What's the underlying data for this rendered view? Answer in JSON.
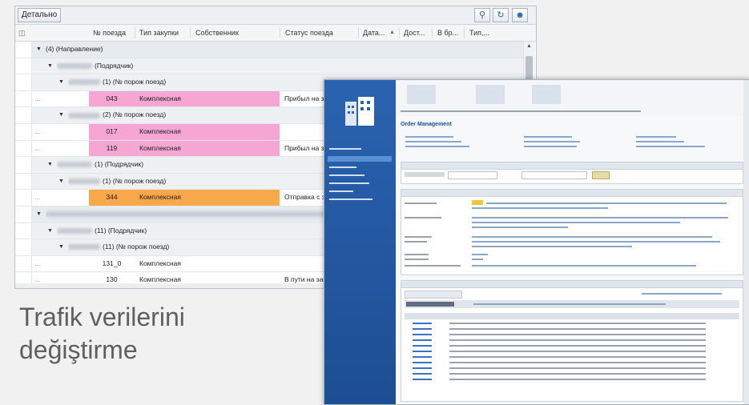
{
  "toolbar": {
    "details_label": "Детально"
  },
  "columns": [
    "№ поезда",
    "Тип закупки",
    "Собственник",
    "Статус поезда",
    "Дата...",
    "Дост...",
    "В бр...",
    "Тип,..."
  ],
  "sort_indicator": "▲",
  "rows": [
    {
      "kind": "grp1",
      "indent": 0,
      "label": "(4) (Направление)"
    },
    {
      "kind": "grp2",
      "indent": 1,
      "label": "(Подрядчик)"
    },
    {
      "kind": "grp2",
      "indent": 2,
      "label": "(1) (№ порож поезд)"
    },
    {
      "kind": "leaf",
      "color": "#f6a6d3",
      "train": "043",
      "type": "Комплексная",
      "status": "Прибыл на заво"
    },
    {
      "kind": "grp2",
      "indent": 2,
      "label": "(2) (№ порож поезд)"
    },
    {
      "kind": "leaf",
      "color": "#f6a6d3",
      "train": "017",
      "type": "Комплексная",
      "status": ""
    },
    {
      "kind": "leaf",
      "color": "#f6a6d3",
      "train": "119",
      "type": "Комплексная",
      "status": "Прибыл на заво"
    },
    {
      "kind": "grp2",
      "indent": 1,
      "label": "(1) (Подрядчик)"
    },
    {
      "kind": "grp2",
      "indent": 2,
      "label": "(1) (№ порож поезд)"
    },
    {
      "kind": "leaf",
      "color": "#f7a84a",
      "train": "344",
      "type": "Комплексная",
      "status": "Отправка с завод"
    },
    {
      "kind": "grp1",
      "indent": 0,
      "label": ""
    },
    {
      "kind": "grp2",
      "indent": 1,
      "label": "(11) (Подрядчик)"
    },
    {
      "kind": "grp2",
      "indent": 2,
      "label": "(11) (№ порож поезд)"
    },
    {
      "kind": "leaf",
      "color": "",
      "train": "131_0",
      "type": "Комплексная",
      "status": ""
    },
    {
      "kind": "leaf",
      "color": "",
      "train": "130",
      "type": "Комплексная",
      "status": "В пути на заво"
    }
  ],
  "caption": {
    "line1": "Trafik verilerini",
    "line2": "değiştirme"
  },
  "second_window": {
    "title": "Order Management"
  }
}
